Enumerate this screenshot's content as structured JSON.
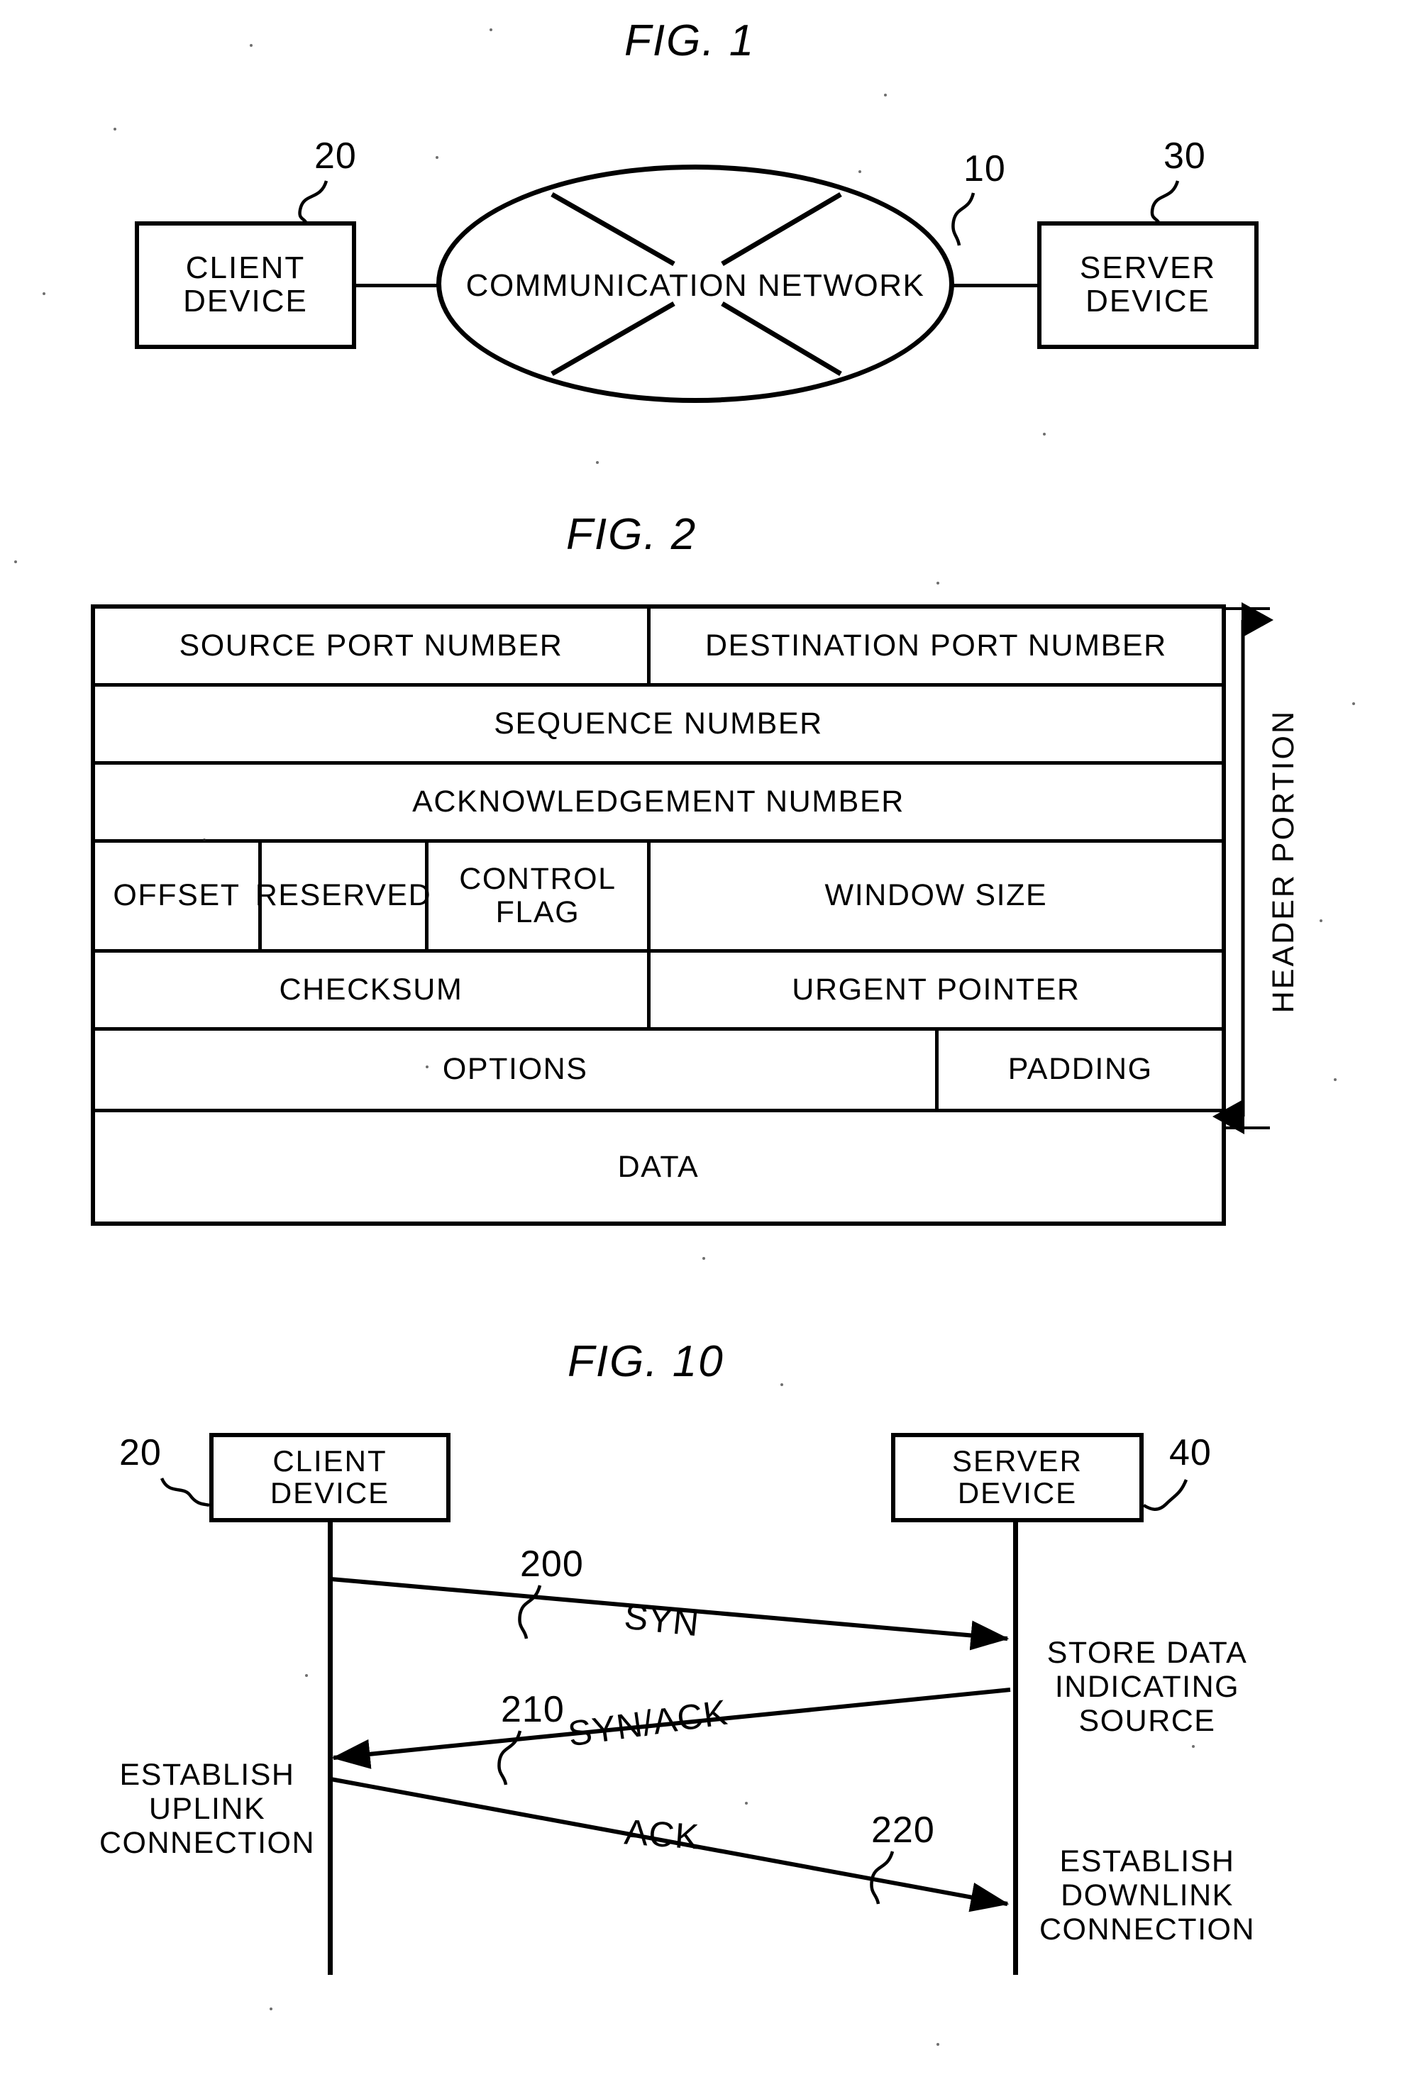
{
  "figures": [
    {
      "id": "fig1",
      "title": "FIG. 1",
      "nodes": {
        "client": {
          "line1": "CLIENT",
          "line2": "DEVICE",
          "ref": "20"
        },
        "network": {
          "label": "COMMUNICATION NETWORK",
          "ref": "10"
        },
        "server": {
          "line1": "SERVER",
          "line2": "DEVICE",
          "ref": "30"
        }
      }
    },
    {
      "id": "fig2",
      "title": "FIG. 2",
      "header_portion_label": "HEADER PORTION",
      "rows": [
        {
          "cells": [
            {
              "text": "SOURCE PORT NUMBER",
              "width": 49.3
            },
            {
              "text": "DESTINATION PORT NUMBER",
              "width": 50.7
            }
          ]
        },
        {
          "cells": [
            {
              "text": "SEQUENCE NUMBER",
              "width": 100
            }
          ]
        },
        {
          "cells": [
            {
              "text": "ACKNOWLEDGEMENT NUMBER",
              "width": 100
            }
          ]
        },
        {
          "cells": [
            {
              "text": "OFFSET",
              "width": 14.8
            },
            {
              "text": "RESERVED",
              "width": 14.8
            },
            {
              "text": "CONTROL\nFLAG",
              "width": 19.7
            },
            {
              "text": "WINDOW SIZE",
              "width": 50.7
            }
          ]
        },
        {
          "cells": [
            {
              "text": "CHECKSUM",
              "width": 49.3
            },
            {
              "text": "URGENT POINTER",
              "width": 50.7
            }
          ]
        },
        {
          "cells": [
            {
              "text": "OPTIONS",
              "width": 74.9
            },
            {
              "text": "PADDING",
              "width": 25.1
            }
          ]
        },
        {
          "cells": [
            {
              "text": "DATA",
              "width": 100
            }
          ]
        }
      ]
    },
    {
      "id": "fig10",
      "title": "FIG. 10",
      "actors": {
        "client": {
          "line1": "CLIENT",
          "line2": "DEVICE",
          "ref": "20"
        },
        "server": {
          "line1": "SERVER",
          "line2": "DEVICE",
          "ref": "40"
        }
      },
      "messages": [
        {
          "label": "SYN",
          "ref": "200",
          "direction": "right"
        },
        {
          "label": "SYN/ACK",
          "ref": "210",
          "direction": "left"
        },
        {
          "label": "ACK",
          "ref": "220",
          "direction": "right"
        }
      ],
      "notes": {
        "server_store": "STORE DATA\nINDICATING\nSOURCE",
        "client_uplink": "ESTABLISH\nUPLINK\nCONNECTION",
        "server_downlink": "ESTABLISH\nDOWNLINK\nCONNECTION"
      }
    }
  ],
  "colors": {
    "ink": "#000000",
    "paper": "#ffffff"
  }
}
